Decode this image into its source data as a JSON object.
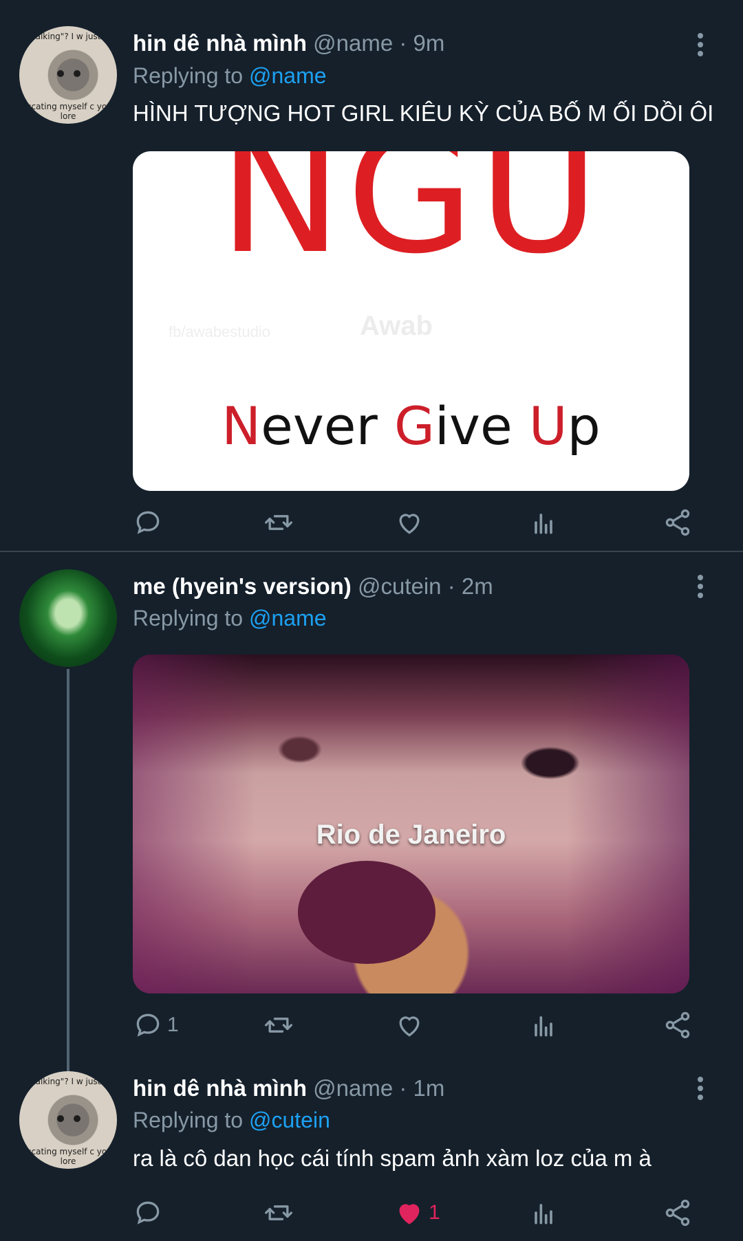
{
  "tweets": [
    {
      "display_name": "hin dê nhà mình",
      "handle_time": "@name · 9m",
      "replying_prefix": "Replying to ",
      "replying_to": "@name",
      "text": "HÌNH TƯỢNG HOT GIRL KIÊU KỲ CỦA BỐ M ỐI DỒI ÔI",
      "avatar_caption_top": "alking\"? I w just",
      "avatar_caption_bottom": "ducating myself c your lore",
      "media": {
        "headline": "NGU",
        "watermark_left": "fb/awabestudio",
        "watermark_center": "Awab",
        "sub_n": "N",
        "sub_ever": "ever ",
        "sub_g": "G",
        "sub_ive": "ive ",
        "sub_u": "U",
        "sub_p": "p"
      },
      "reply_count": "",
      "like_count": ""
    },
    {
      "display_name": "me (hyein's version)",
      "handle_time": "@cutein · 2m",
      "replying_prefix": "Replying to ",
      "replying_to": "@name",
      "media": {
        "caption": "Rio de Janeiro"
      },
      "reply_count": "1",
      "like_count": ""
    },
    {
      "display_name": "hin dê nhà mình",
      "handle_time": "@name · 1m",
      "replying_prefix": "Replying to ",
      "replying_to": "@cutein",
      "text": "ra là cô dan học cái tính spam ảnh xàm loz của m à",
      "avatar_caption_top": "alking\"? I w just",
      "avatar_caption_bottom": "ducating myself c your lore",
      "reply_count": "",
      "like_count": "1",
      "liked": true
    }
  ],
  "colors": {
    "background": "#15202b",
    "muted": "#8899a6",
    "mention": "#1da1f2",
    "like_active": "#e0245e",
    "ngu_red": "#dd1f23"
  },
  "icons": [
    "reply-icon",
    "retweet-icon",
    "like-icon",
    "analytics-icon",
    "share-icon",
    "more-icon"
  ]
}
